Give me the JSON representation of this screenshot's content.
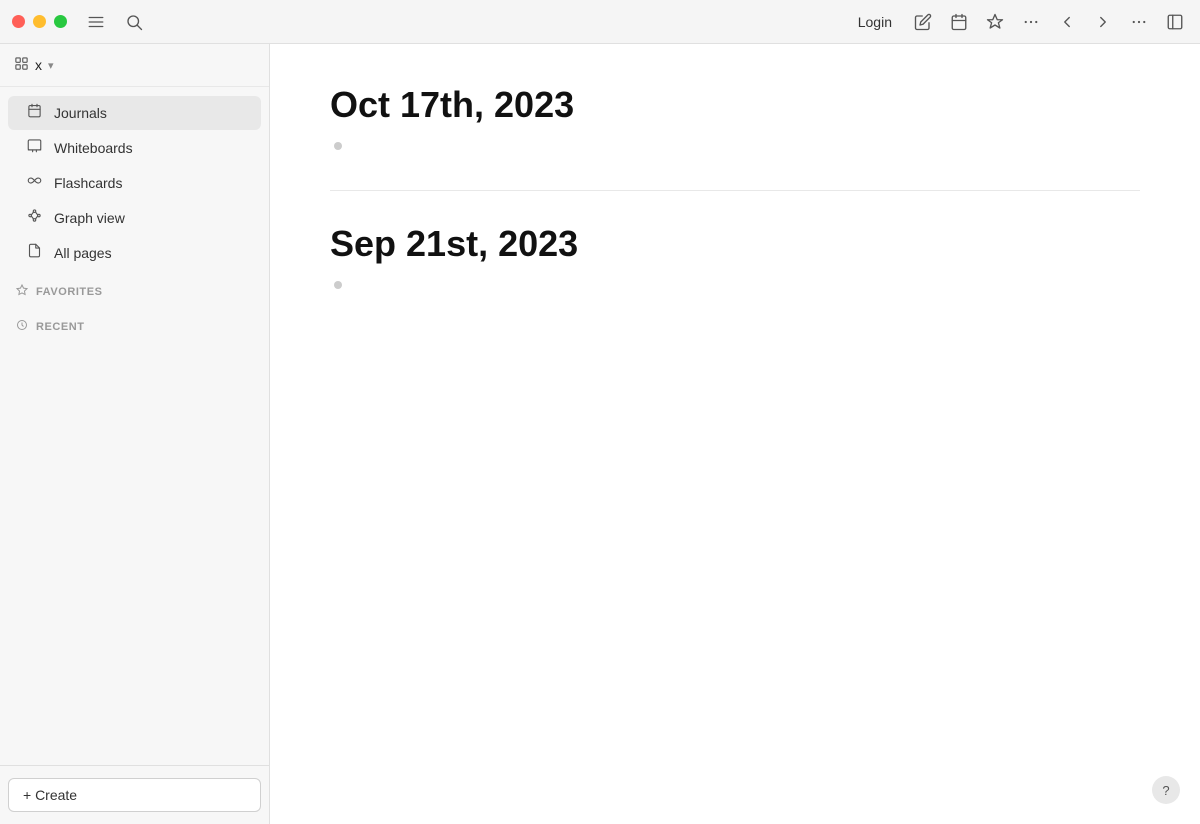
{
  "titlebar": {
    "login_label": "Login",
    "traffic_lights": [
      "red",
      "yellow",
      "green"
    ]
  },
  "sidebar": {
    "workspace_name": "x",
    "nav_items": [
      {
        "id": "journals",
        "label": "Journals",
        "icon": "calendar",
        "active": true
      },
      {
        "id": "whiteboards",
        "label": "Whiteboards",
        "icon": "whiteboard",
        "active": false
      },
      {
        "id": "flashcards",
        "label": "Flashcards",
        "icon": "infinity",
        "active": false
      },
      {
        "id": "graph-view",
        "label": "Graph view",
        "icon": "graph",
        "active": false
      },
      {
        "id": "all-pages",
        "label": "All pages",
        "icon": "pages",
        "active": false
      }
    ],
    "sections": [
      {
        "id": "favorites",
        "label": "FAVORITES"
      },
      {
        "id": "recent",
        "label": "RECENT"
      }
    ],
    "create_label": "+ Create"
  },
  "main": {
    "journal_entries": [
      {
        "id": "entry-1",
        "date": "Oct 17th, 2023"
      },
      {
        "id": "entry-2",
        "date": "Sep 21st, 2023"
      }
    ]
  },
  "help": {
    "label": "?"
  }
}
